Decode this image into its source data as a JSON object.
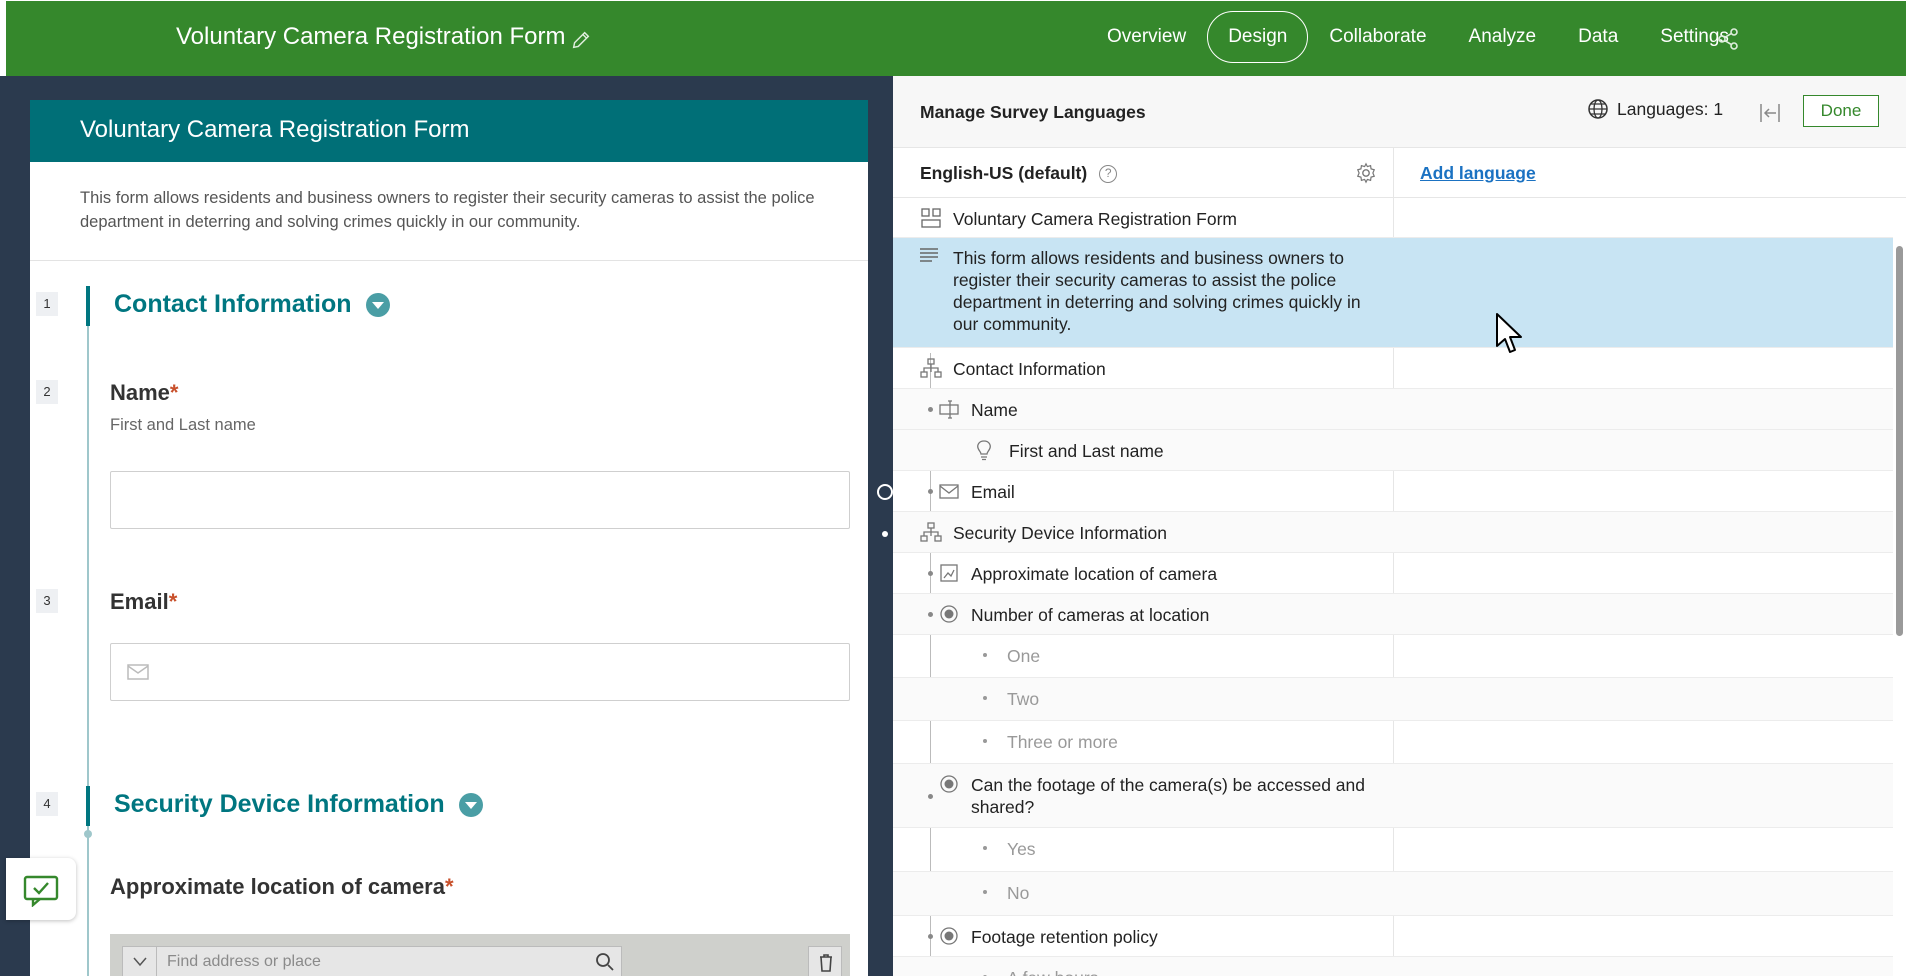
{
  "app": {
    "title": "Voluntary Camera Registration Form",
    "tabs": [
      "Overview",
      "Design",
      "Collaborate",
      "Analyze",
      "Data",
      "Settings"
    ],
    "active_tab": "Design"
  },
  "form": {
    "header": "Voluntary Camera Registration Form",
    "description": "This form allows residents and business owners to register their security cameras to assist the police department in deterring and solving crimes quickly in our community.",
    "numbers": [
      "1",
      "2",
      "3",
      "4"
    ],
    "section1": "Contact Information",
    "name_label": "Name",
    "name_hint": "First and Last name",
    "email_label": "Email",
    "section2": "Security Device Information",
    "location_label": "Approximate location of camera",
    "required_mark": "*",
    "map_search_placeholder": "Find address or place"
  },
  "languages_panel": {
    "title": "Manage Survey Languages",
    "languages_count": "Languages: 1",
    "done_label": "Done",
    "default_language": "English-US (default)",
    "add_language": "Add language",
    "rows": [
      {
        "text": "Voluntary Camera Registration Form",
        "icon": "form-icon"
      },
      {
        "text": "This form allows residents and business owners to register their security cameras to assist the police department in deterring and solving crimes quickly in our community.",
        "icon": "description-icon"
      },
      {
        "text": "Contact Information",
        "icon": "group-icon"
      },
      {
        "text": "Name",
        "icon": "text-field-icon"
      },
      {
        "text": "First and Last name",
        "icon": "hint-icon"
      },
      {
        "text": "Email",
        "icon": "email-icon"
      },
      {
        "text": "Security Device Information",
        "icon": "group-icon"
      },
      {
        "text": "Approximate location of camera",
        "icon": "map-icon"
      },
      {
        "text": "Number of cameras at location",
        "icon": "radio-icon"
      },
      {
        "text": "One",
        "icon": "option-bullet"
      },
      {
        "text": "Two",
        "icon": "option-bullet"
      },
      {
        "text": "Three or more",
        "icon": "option-bullet"
      },
      {
        "text": "Can the footage of the camera(s) be accessed and shared?",
        "icon": "radio-icon"
      },
      {
        "text": "Yes",
        "icon": "option-bullet"
      },
      {
        "text": "No",
        "icon": "option-bullet"
      },
      {
        "text": "Footage retention policy",
        "icon": "radio-icon"
      },
      {
        "text": "A few hours",
        "icon": "option-bullet"
      }
    ]
  },
  "colors": {
    "topbar": "#35882c",
    "form_header": "#006f77",
    "accent": "#007680",
    "selected_row": "#c8e4f3",
    "link": "#1b72c2"
  }
}
